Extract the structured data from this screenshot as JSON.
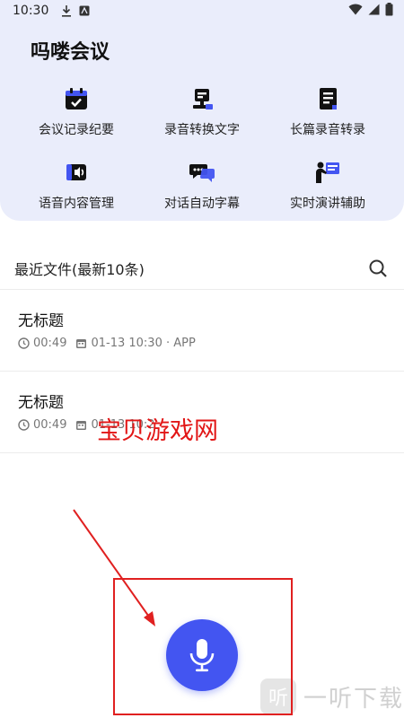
{
  "status_bar": {
    "time": "10:30"
  },
  "app": {
    "title": "吗喽会议"
  },
  "features": [
    {
      "label": "会议记录纪要",
      "icon": "calendar-check-icon"
    },
    {
      "label": "录音转换文字",
      "icon": "recorder-icon"
    },
    {
      "label": "长篇录音转录",
      "icon": "document-icon"
    },
    {
      "label": "语音内容管理",
      "icon": "speaker-manage-icon"
    },
    {
      "label": "对话自动字幕",
      "icon": "chat-bubbles-icon"
    },
    {
      "label": "实时演讲辅助",
      "icon": "presenter-icon"
    }
  ],
  "recent": {
    "title": "最近文件(最新10条)",
    "items": [
      {
        "title": "无标题",
        "duration": "00:49",
        "datetime": "01-13 10:30 · APP"
      },
      {
        "title": "无标题",
        "duration": "00:49",
        "datetime": "01-13 10:2"
      }
    ]
  },
  "watermark": {
    "text": "宝贝游戏网",
    "brand": "一听下载",
    "logo_char": "听"
  },
  "colors": {
    "accent": "#4355f1",
    "header_bg": "#eaedfb",
    "annotation_red": "#e02020"
  }
}
